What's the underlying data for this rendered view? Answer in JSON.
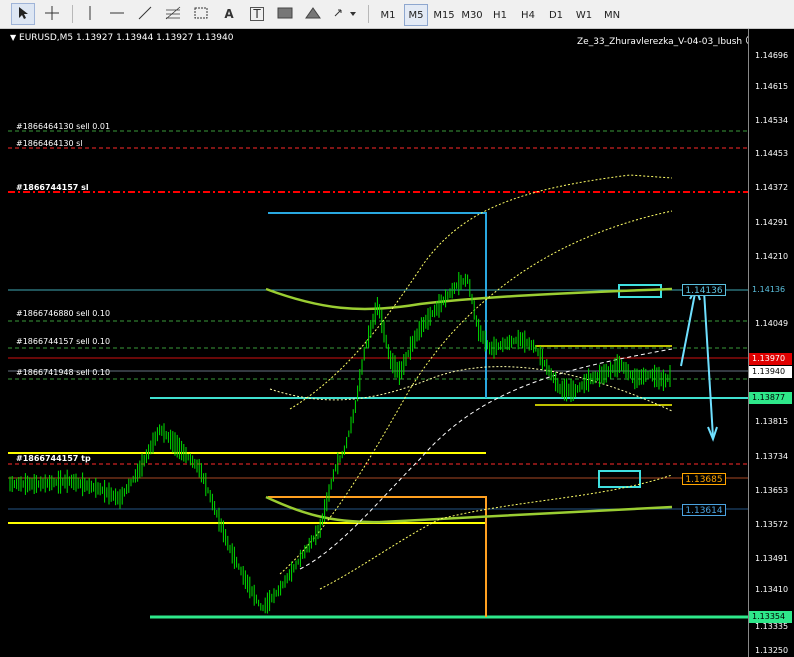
{
  "toolbar": {
    "timeframes": [
      "M1",
      "M5",
      "M15",
      "M30",
      "H1",
      "H4",
      "D1",
      "W1",
      "MN"
    ],
    "selected_timeframe": "M5",
    "text_tool": "A",
    "label_tool": "T"
  },
  "chart": {
    "symbol_info": "EURUSD,M5  1.13927 1.13944 1.13927 1.13940",
    "expert": "Ze_33_Zhuravlerezka_V-04-03_Ibush",
    "order_labels": [
      "#1866464130 sell 0.01",
      "#1866464130 sl",
      "#1866744157 sl",
      "#1866746880 sell 0.10",
      "#1866744157 sell 0.10",
      "#1866741948 sell 0.10",
      "#1866744157 tp"
    ],
    "axis_ticks": [
      "1.14696",
      "1.14615",
      "1.14534",
      "1.14453",
      "1.14372",
      "1.14291",
      "1.14210",
      "1.14130",
      "1.14049",
      "1.13968",
      "1.13887",
      "1.13815",
      "1.13734",
      "1.13653",
      "1.13572",
      "1.13491",
      "1.13410",
      "1.13335",
      "1.13250"
    ],
    "price_labels": {
      "level_cyan": "1.14136",
      "red_level": "1.13970",
      "current": "1.13940",
      "green_level": "1.13877",
      "orange_level": "1.13685",
      "blue_level": "1.13614",
      "green_bottom": "1.13354"
    },
    "colors": {
      "background": "#000000",
      "candles": "#00ff00",
      "cyan": "#00bfff",
      "yellow": "#ffff00",
      "orange": "#ffa500",
      "red": "#ff0000",
      "lime": "#9acd32",
      "green_line": "#00e08a"
    }
  }
}
